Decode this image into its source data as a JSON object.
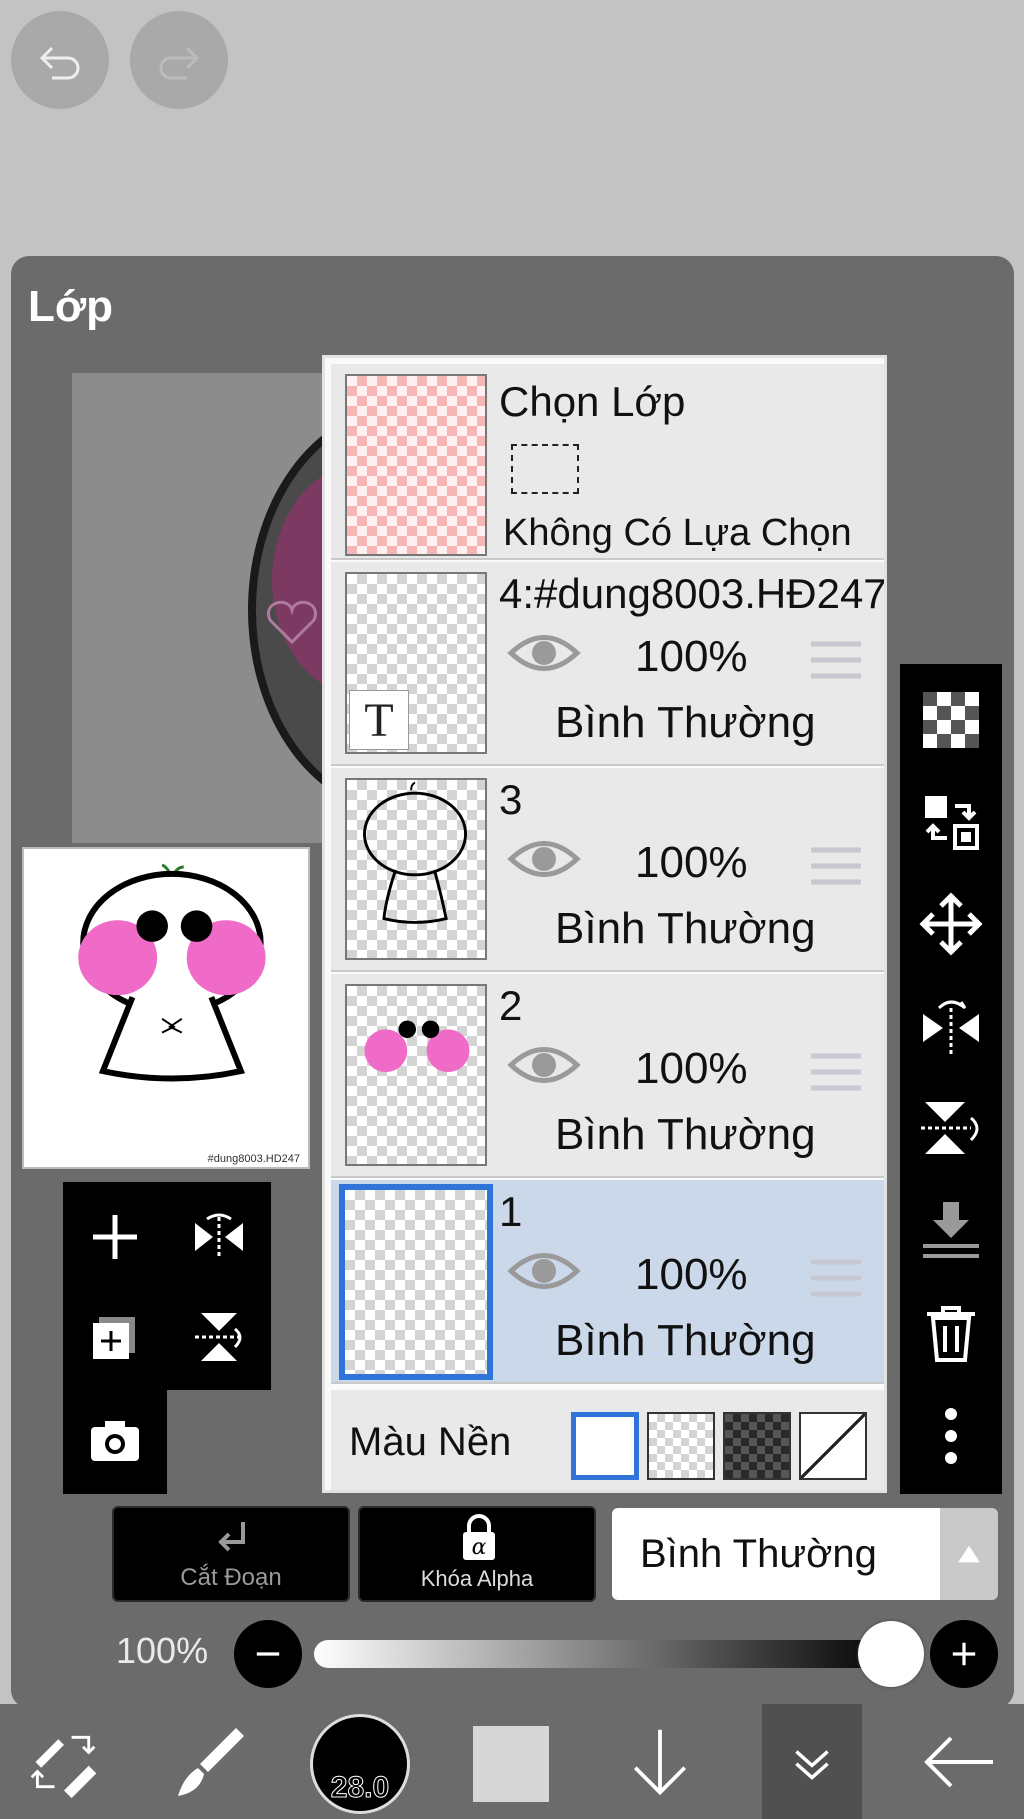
{
  "panel": {
    "title": "Lớp"
  },
  "preview": {
    "watermark": "#dung8003.HD247"
  },
  "selection_layer": {
    "title": "Chọn Lớp",
    "status": "Không Có Lựa Chọn"
  },
  "layers": [
    {
      "name": "4:#dung8003.HĐ247",
      "opacity": "100%",
      "blend": "Bình Thường",
      "selected": false,
      "type": "text",
      "type_icon": "T"
    },
    {
      "name": "3",
      "opacity": "100%",
      "blend": "Bình Thường",
      "selected": false
    },
    {
      "name": "2",
      "opacity": "100%",
      "blend": "Bình Thường",
      "selected": false
    },
    {
      "name": "1",
      "opacity": "100%",
      "blend": "Bình Thường",
      "selected": true
    }
  ],
  "background": {
    "label": "Màu Nền",
    "options": [
      "white",
      "transparent",
      "dark-checker",
      "none"
    ],
    "selected": "white"
  },
  "actions": {
    "clip_label": "Cắt Đoạn",
    "alpha_lock_label": "Khóa Alpha"
  },
  "blend_mode": {
    "value": "Bình Thường"
  },
  "opacity": {
    "label": "100%",
    "value": 1.0
  },
  "brush": {
    "size": "28.0"
  },
  "colors": {
    "accent": "#2f74d9",
    "selected_row": "#cbd8ea",
    "panel": "#6b6b6b",
    "current_color": "#d7d7d7"
  }
}
